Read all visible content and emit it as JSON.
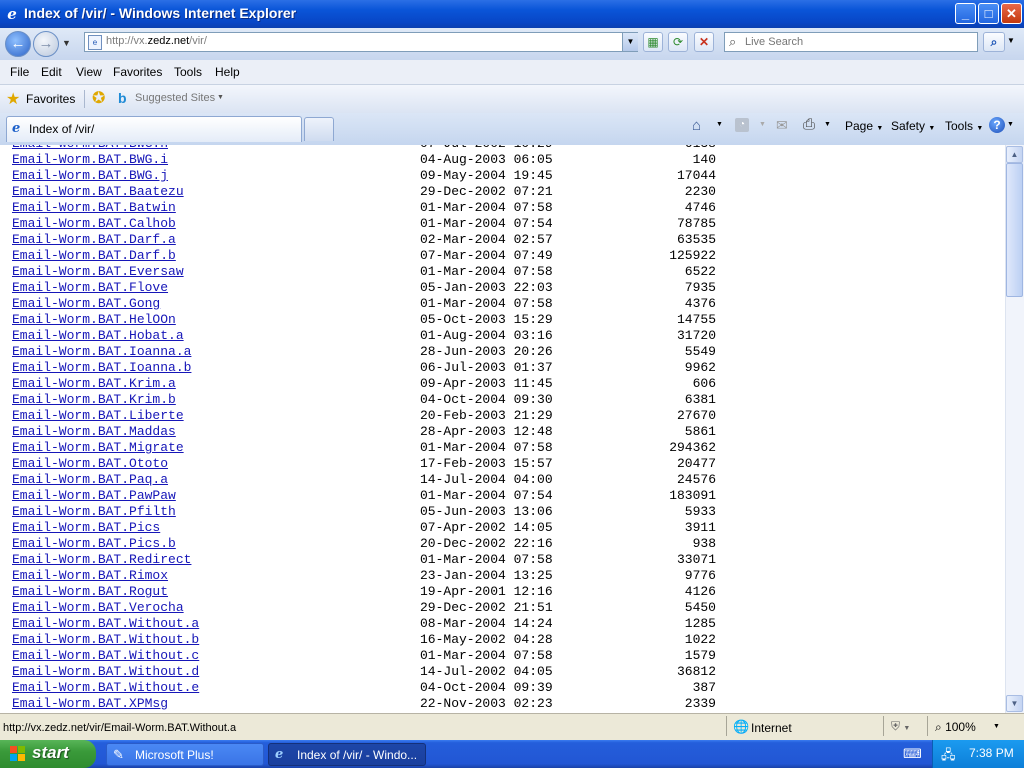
{
  "window": {
    "title": "Index of /vir/ - Windows Internet Explorer",
    "minimize": "_",
    "maximize": "□",
    "close": "✕"
  },
  "address": {
    "url_prefix": "http://vx.",
    "url_domain": "zedz.net",
    "url_suffix": "/vir/",
    "search_placeholder": "Live Search"
  },
  "menu": [
    "File",
    "Edit",
    "View",
    "Favorites",
    "Tools",
    "Help"
  ],
  "favorites_bar": {
    "favorites_label": "Favorites",
    "suggested_label": "Suggested Sites"
  },
  "tabs": [
    {
      "label": "Index of /vir/"
    }
  ],
  "command_bar": {
    "page_label": "Page",
    "safety_label": "Safety",
    "tools_label": "Tools"
  },
  "listing": [
    {
      "name": "Email-Worm.BAT.BWG.i",
      "date": "04-Aug-2003 06:05",
      "size": "140"
    },
    {
      "name": "Email-Worm.BAT.BWG.j",
      "date": "09-May-2004 19:45",
      "size": "17044"
    },
    {
      "name": "Email-Worm.BAT.Baatezu",
      "date": "29-Dec-2002 07:21",
      "size": "2230"
    },
    {
      "name": "Email-Worm.BAT.Batwin",
      "date": "01-Mar-2004 07:58",
      "size": "4746"
    },
    {
      "name": "Email-Worm.BAT.Calhob",
      "date": "01-Mar-2004 07:54",
      "size": "78785"
    },
    {
      "name": "Email-Worm.BAT.Darf.a",
      "date": "02-Mar-2004 02:57",
      "size": "63535"
    },
    {
      "name": "Email-Worm.BAT.Darf.b",
      "date": "07-Mar-2004 07:49",
      "size": "125922"
    },
    {
      "name": "Email-Worm.BAT.Eversaw",
      "date": "01-Mar-2004 07:58",
      "size": "6522"
    },
    {
      "name": "Email-Worm.BAT.Flove",
      "date": "05-Jan-2003 22:03",
      "size": "7935"
    },
    {
      "name": "Email-Worm.BAT.Gong",
      "date": "01-Mar-2004 07:58",
      "size": "4376"
    },
    {
      "name": "Email-Worm.BAT.HelOOn",
      "date": "05-Oct-2003 15:29",
      "size": "14755"
    },
    {
      "name": "Email-Worm.BAT.Hobat.a",
      "date": "01-Aug-2004 03:16",
      "size": "31720"
    },
    {
      "name": "Email-Worm.BAT.Ioanna.a",
      "date": "28-Jun-2003 20:26",
      "size": "5549"
    },
    {
      "name": "Email-Worm.BAT.Ioanna.b",
      "date": "06-Jul-2003 01:37",
      "size": "9962"
    },
    {
      "name": "Email-Worm.BAT.Krim.a",
      "date": "09-Apr-2003 11:45",
      "size": "606"
    },
    {
      "name": "Email-Worm.BAT.Krim.b",
      "date": "04-Oct-2004 09:30",
      "size": "6381"
    },
    {
      "name": "Email-Worm.BAT.Liberte",
      "date": "20-Feb-2003 21:29",
      "size": "27670"
    },
    {
      "name": "Email-Worm.BAT.Maddas",
      "date": "28-Apr-2003 12:48",
      "size": "5861"
    },
    {
      "name": "Email-Worm.BAT.Migrate",
      "date": "01-Mar-2004 07:58",
      "size": "294362"
    },
    {
      "name": "Email-Worm.BAT.Ototo",
      "date": "17-Feb-2003 15:57",
      "size": "20477"
    },
    {
      "name": "Email-Worm.BAT.Paq.a",
      "date": "14-Jul-2004 04:00",
      "size": "24576"
    },
    {
      "name": "Email-Worm.BAT.PawPaw",
      "date": "01-Mar-2004 07:54",
      "size": "183091"
    },
    {
      "name": "Email-Worm.BAT.Pfilth",
      "date": "05-Jun-2003 13:06",
      "size": "5933"
    },
    {
      "name": "Email-Worm.BAT.Pics",
      "date": "07-Apr-2002 14:05",
      "size": "3911"
    },
    {
      "name": "Email-Worm.BAT.Pics.b",
      "date": "20-Dec-2002 22:16",
      "size": "938"
    },
    {
      "name": "Email-Worm.BAT.Redirect",
      "date": "01-Mar-2004 07:58",
      "size": "33071"
    },
    {
      "name": "Email-Worm.BAT.Rimox",
      "date": "23-Jan-2004 13:25",
      "size": "9776"
    },
    {
      "name": "Email-Worm.BAT.Rogut",
      "date": "19-Apr-2001 12:16",
      "size": "4126"
    },
    {
      "name": "Email-Worm.BAT.Verocha",
      "date": "29-Dec-2002 21:51",
      "size": "5450"
    },
    {
      "name": "Email-Worm.BAT.Without.a",
      "date": "08-Mar-2004 14:24",
      "size": "1285"
    },
    {
      "name": "Email-Worm.BAT.Without.b",
      "date": "16-May-2002 04:28",
      "size": "1022"
    },
    {
      "name": "Email-Worm.BAT.Without.c",
      "date": "01-Mar-2004 07:58",
      "size": "1579"
    },
    {
      "name": "Email-Worm.BAT.Without.d",
      "date": "14-Jul-2002 04:05",
      "size": "36812"
    },
    {
      "name": "Email-Worm.BAT.Without.e",
      "date": "04-Oct-2004 09:39",
      "size": "387"
    },
    {
      "name": "Email-Worm.BAT.XPMsg",
      "date": "22-Nov-2003 02:23",
      "size": "2339"
    }
  ],
  "statusbar": {
    "status_text": "http://vx.zedz.net/vir/Email-Worm.BAT.Without.a",
    "zone": "Internet",
    "zoom": "100%"
  },
  "taskbar": {
    "start_label": "start",
    "items": [
      {
        "label": "Microsoft Plus!"
      },
      {
        "label": "Index of /vir/ - Windo..."
      }
    ],
    "clock": "7:38 PM"
  },
  "colors": {
    "link": "#1616b8",
    "titlebar": "#0a55d8",
    "start_green": "#3a9a3a"
  }
}
